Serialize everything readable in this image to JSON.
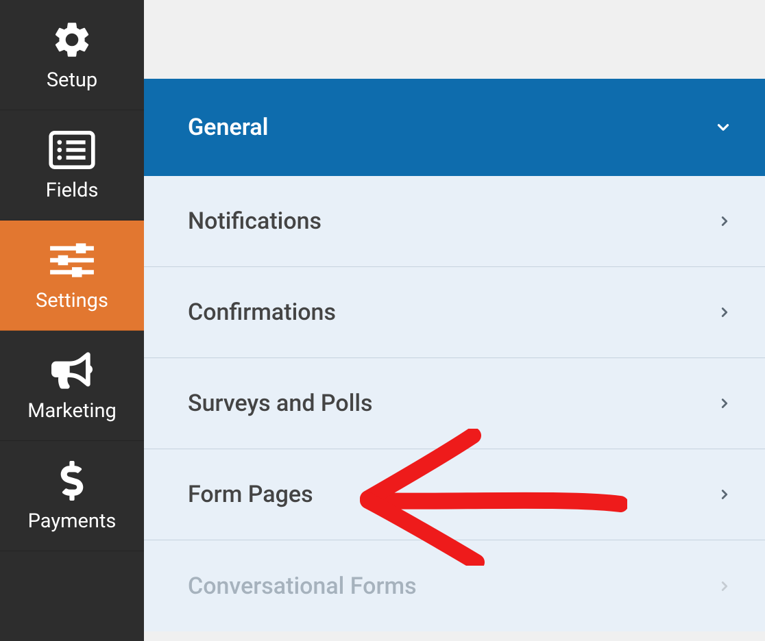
{
  "sidebar": {
    "items": [
      {
        "label": "Setup"
      },
      {
        "label": "Fields"
      },
      {
        "label": "Settings"
      },
      {
        "label": "Marketing"
      },
      {
        "label": "Payments"
      }
    ]
  },
  "settings": {
    "items": [
      {
        "label": "General"
      },
      {
        "label": "Notifications"
      },
      {
        "label": "Confirmations"
      },
      {
        "label": "Surveys and Polls"
      },
      {
        "label": "Form Pages"
      },
      {
        "label": "Conversational Forms"
      }
    ]
  }
}
